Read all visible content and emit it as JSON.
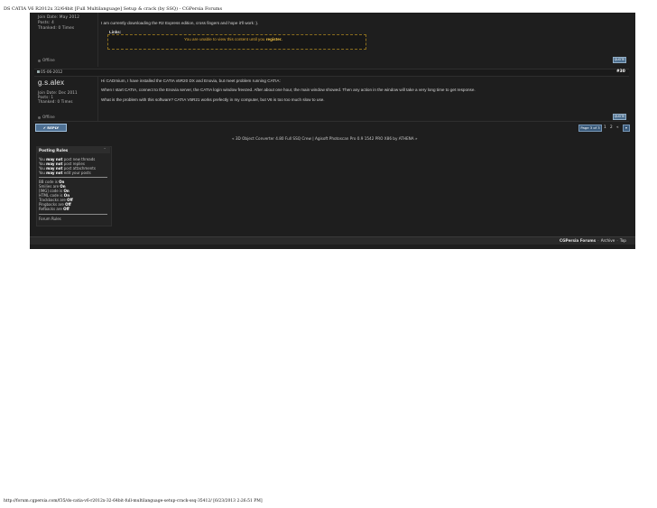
{
  "print_header": {
    "title": "DS CATIA V6 R2012x 32/64bit [Full Multilanguage] Setup & crack (by SSQ) - CGPersia Forums"
  },
  "print_footer": {
    "url": "http://forum.cgpersia.com/f35/ds-catia-v6-r2012x-32-64bit-full-multilanguage-setup-crack-ssq-35412/ [6/23/2013 2:26:51 PM]"
  },
  "post_prev": {
    "join_date": "Join Date: May 2012",
    "posts": "Posts: 4",
    "thanked": "Thanked: 0 Times",
    "message": "I am currently downloading the R2 Express edition, cross fingers and hope it'll work :).",
    "links_label": "Links:",
    "links_notice": "You are unable to view this content until you",
    "links_action": "register.",
    "status": "Offline",
    "quote_label": "QUOTE"
  },
  "post_main": {
    "date": "05-06-2012",
    "number": "#30",
    "username": "g.s.alex",
    "join_date": "Join Date: Dec 2011",
    "posts": "Posts: 1",
    "thanked": "Thanked: 0 Times",
    "line1": "Hi CADmium, I have installed the CATIA v5R20 DX and Enovia, but meet problem running CATIA:",
    "line2": "When I start CATIA, connect to the Enovia server, the CATIA login window freezed. After about one hour, the main window showed. Then any action in the window will take a very long time to get response.",
    "line3": "What is the problem with this software? CATIA V5R21 works prefectly in my computer, but V6 is too too much slow to use.",
    "status": "Offline",
    "quote_label": "QUOTE"
  },
  "thread_controls": {
    "reply_label": "✔ REPLY",
    "page_label": "Page 3 of 3",
    "pages": [
      "1",
      "2"
    ],
    "pager_prev": "«",
    "pager_end": "▾"
  },
  "nav_line": "« 3D Object Converter 4.80 Full SSQ Crew | Agisoft Photoscan Pro 0.9 1542 PRO X86 by ATHENA »",
  "posting_rules": {
    "title": "Posting Rules",
    "collapse": "–",
    "lines": [
      {
        "pre": "You ",
        "strong": "may not",
        "post": " post new threads"
      },
      {
        "pre": "You ",
        "strong": "may not",
        "post": " post replies"
      },
      {
        "pre": "You ",
        "strong": "may not",
        "post": " post attachments"
      },
      {
        "pre": "You ",
        "strong": "may not",
        "post": " edit your posts"
      }
    ],
    "codes": [
      {
        "pre": "BB code is ",
        "strong": "On"
      },
      {
        "pre": "Smilies are ",
        "strong": "On"
      },
      {
        "pre": "[IMG] code is ",
        "strong": "On"
      },
      {
        "pre": "HTML code is ",
        "strong": "On"
      },
      {
        "pre": "Trackbacks are ",
        "strong": "Off"
      },
      {
        "pre": "Pingbacks are ",
        "strong": "Off"
      },
      {
        "pre": "Refbacks are ",
        "strong": "Off"
      }
    ],
    "forum_rules": "Forum Rules"
  },
  "footer_links": {
    "forum": "CGPersia Forums",
    "archive": "Archive",
    "top": "Top",
    "separator": "-"
  },
  "colors": {
    "panel": "#1e1e1e",
    "link_gold": "#d9a531",
    "button_blue": "#4e7093"
  }
}
